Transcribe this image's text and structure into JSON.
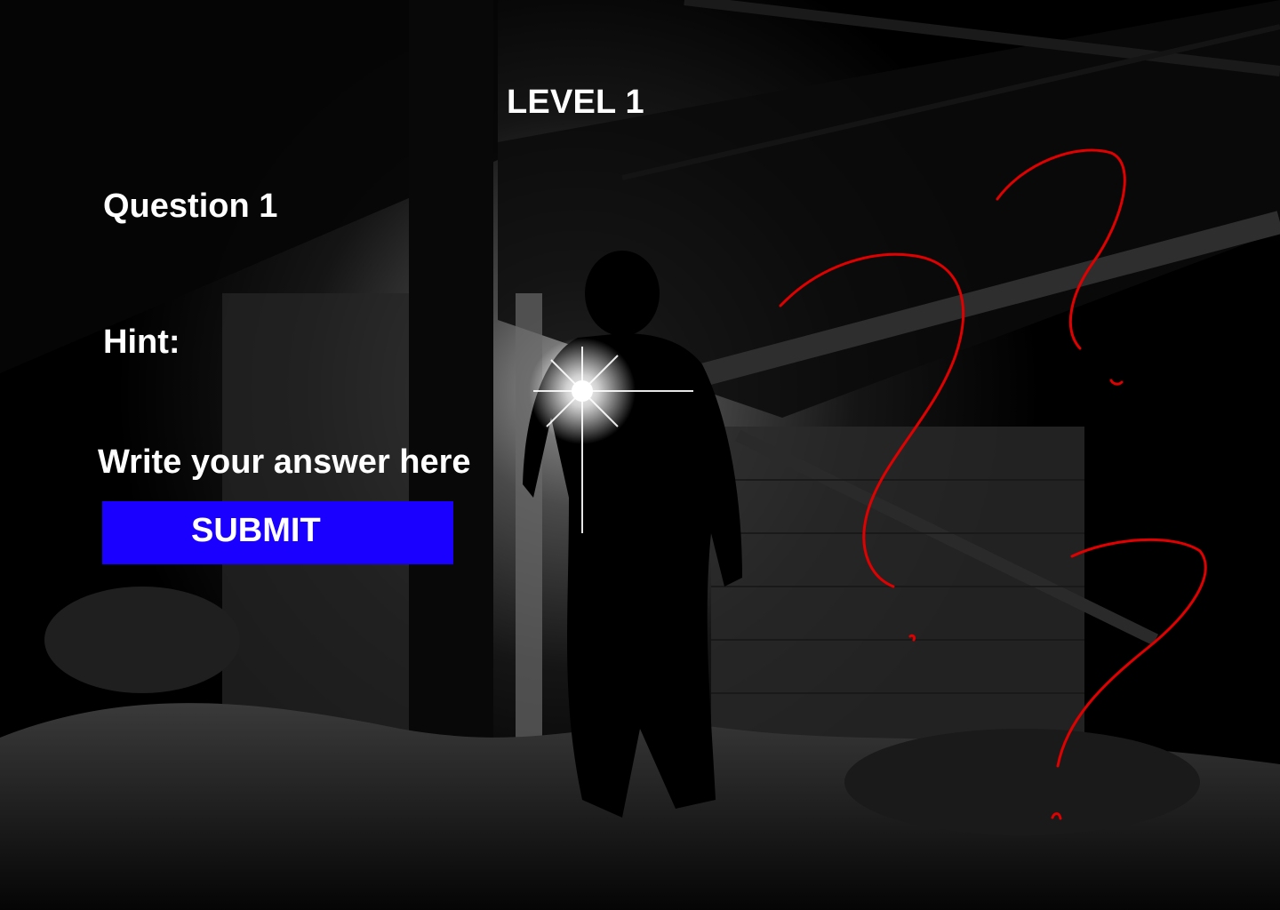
{
  "level": {
    "title": "LEVEL 1"
  },
  "question": {
    "label": "Question 1"
  },
  "hint": {
    "label": "Hint:"
  },
  "answer": {
    "placeholder": "Write your answer here"
  },
  "submit": {
    "label": "SUBMIT"
  },
  "colors": {
    "background": "#000000",
    "text": "#ffffff",
    "submit_button": "#1a00ff",
    "question_marks": "#e00000"
  },
  "background_image": {
    "subject": "dark attic with silhouetted figure holding a flashlight"
  },
  "decorations": {
    "icon": "question-mark-icon",
    "count": 3
  }
}
